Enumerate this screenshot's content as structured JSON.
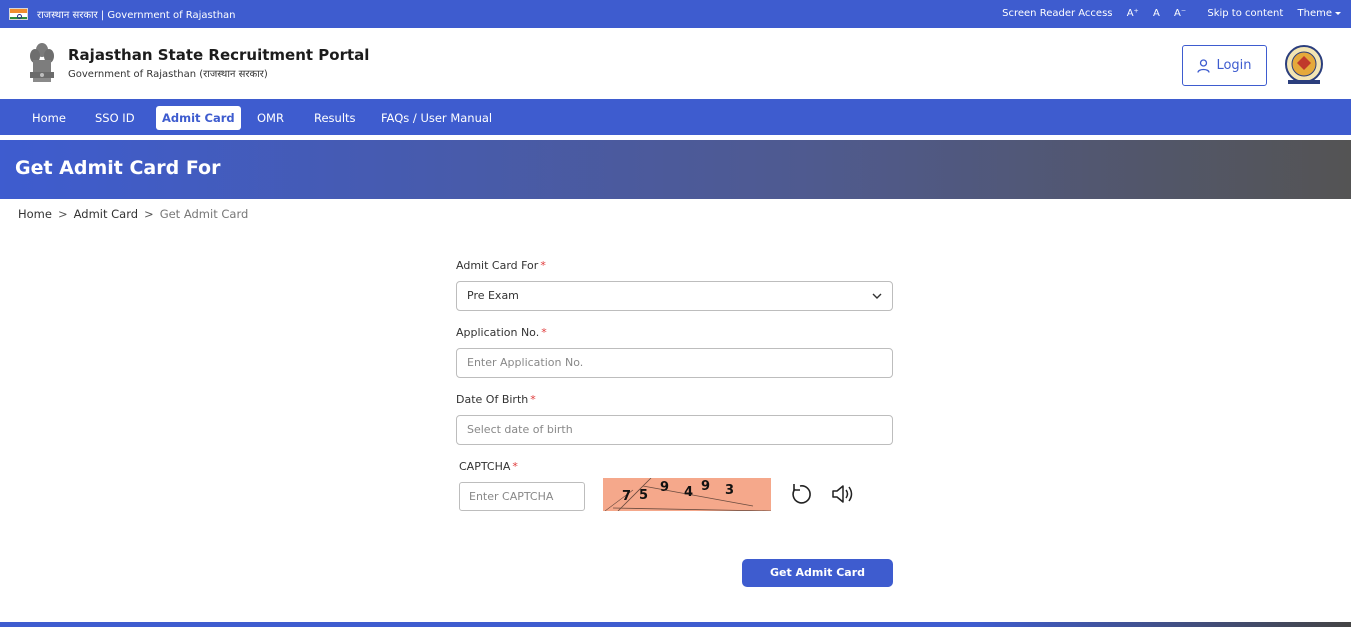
{
  "topbar": {
    "gov_text": "राजस्थान सरकार | Government of Rajasthan",
    "screen_reader": "Screen Reader Access",
    "font_increase": "A⁺",
    "font_normal": "A",
    "font_decrease": "A⁻",
    "skip": "Skip to content",
    "theme": "Theme"
  },
  "header": {
    "title": "Rajasthan State Recruitment Portal",
    "subtitle": "Government of Rajasthan (राजस्थान सरकार)",
    "login_label": "Login"
  },
  "nav": {
    "items": [
      "Home",
      "SSO ID",
      "Admit Card",
      "OMR",
      "Results",
      "FAQs / User Manual"
    ],
    "active": "Admit Card"
  },
  "banner": {
    "title": "Get Admit Card For"
  },
  "breadcrumb": {
    "home": "Home",
    "section": "Admit Card",
    "current": "Get Admit Card",
    "separator": ">"
  },
  "form": {
    "admit_for_label": "Admit Card For",
    "admit_for_value": "Pre Exam",
    "application_label": "Application No.",
    "application_placeholder": "Enter Application No.",
    "dob_label": "Date Of Birth",
    "dob_placeholder": "Select date of birth",
    "captcha_label": "CAPTCHA",
    "captcha_placeholder": "Enter CAPTCHA",
    "captcha_chars": [
      "7",
      "5",
      "9",
      "4",
      "9",
      "3"
    ],
    "required_mark": "*",
    "submit_label": "Get Admit Card"
  },
  "colors": {
    "primary": "#3e5ccf",
    "required": "#e03b3b",
    "captcha_bg": "#f5a88b"
  },
  "icons": {
    "login": "user-icon",
    "select": "chevron-down-icon",
    "refresh": "refresh-icon",
    "audio": "speaker-icon"
  }
}
